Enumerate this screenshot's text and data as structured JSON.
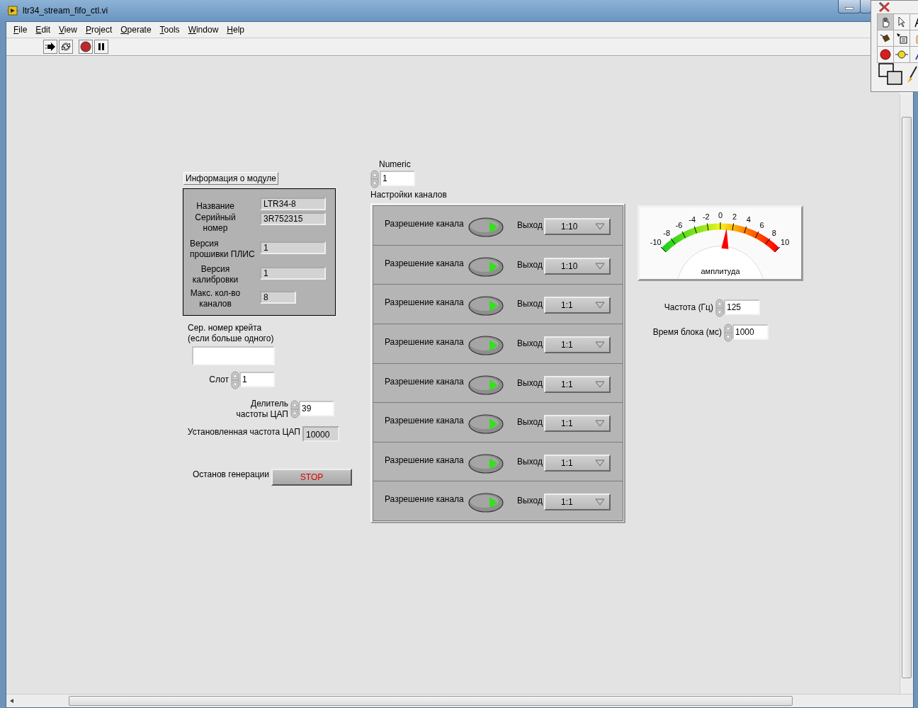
{
  "window": {
    "title": "ltr34_stream_fifo_ctl.vi"
  },
  "menu": [
    "File",
    "Edit",
    "View",
    "Project",
    "Operate",
    "Tools",
    "Window",
    "Help"
  ],
  "module_info": {
    "title": "Информация о модуле",
    "fields": [
      {
        "label": "Название",
        "value": "LTR34-8"
      },
      {
        "label": "Серийный\nномер",
        "value": "3R752315"
      },
      {
        "label": "Версия\nпрошивки ПЛИС",
        "value": "1"
      },
      {
        "label": "Версия\nкалибровки",
        "value": "1"
      },
      {
        "label": "Макс. кол-во\nканалов",
        "value": "8"
      }
    ]
  },
  "crate_serial": {
    "label": "Сер. номер крейта\n(если больше одного)"
  },
  "slot": {
    "label": "Слот",
    "value": "1"
  },
  "dac_divider": {
    "label": "Делитель\nчастоты ЦАП",
    "value": "39"
  },
  "dac_frequency": {
    "label": "Установленная частота ЦАП",
    "value": "10000"
  },
  "stop": {
    "label": "Останов генерации",
    "button": "STOP"
  },
  "numeric": {
    "label": "Numeric",
    "value": "1"
  },
  "channel_settings": {
    "label": "Настройки каналов",
    "rows": [
      {
        "label": "Разрешение канала",
        "on": true,
        "output_label": "Выход",
        "output": "1:10"
      },
      {
        "label": "Разрешение канала",
        "on": true,
        "output_label": "Выход",
        "output": "1:10"
      },
      {
        "label": "Разрешение канала",
        "on": true,
        "output_label": "Выход",
        "output": "1:1"
      },
      {
        "label": "Разрешение канала",
        "on": true,
        "output_label": "Выход",
        "output": "1:1"
      },
      {
        "label": "Разрешение канала",
        "on": true,
        "output_label": "Выход",
        "output": "1:1"
      },
      {
        "label": "Разрешение канала",
        "on": true,
        "output_label": "Выход",
        "output": "1:1"
      },
      {
        "label": "Разрешение канала",
        "on": true,
        "output_label": "Выход",
        "output": "1:1"
      },
      {
        "label": "Разрешение канала",
        "on": true,
        "output_label": "Выход",
        "output": "1:1"
      }
    ]
  },
  "meter": {
    "label": "амплитуда",
    "ticks": [
      "-10",
      "-8",
      "-6",
      "-4",
      "-2",
      "0",
      "2",
      "4",
      "6",
      "8",
      "10"
    ],
    "level": 0.55
  },
  "frequency": {
    "label": "Частота (Гц)",
    "value": "125"
  },
  "block_time": {
    "label": "Время блока (мс)",
    "value": "1000"
  }
}
